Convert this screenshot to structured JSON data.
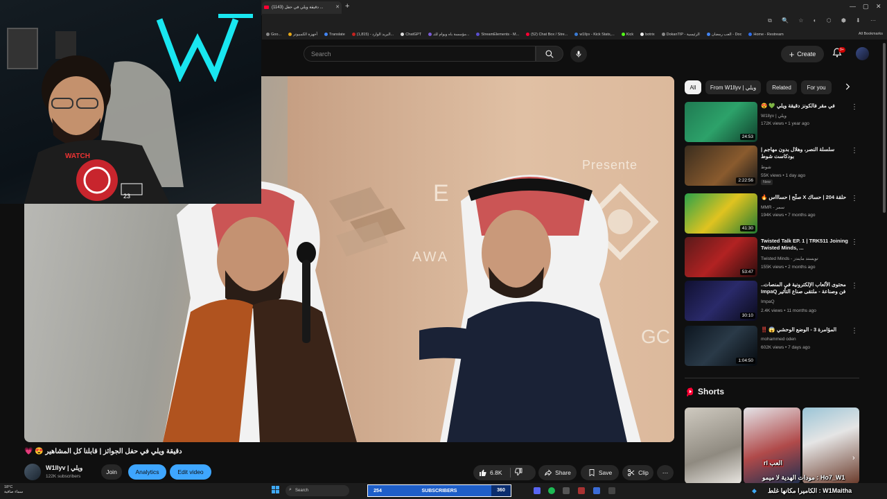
{
  "browser": {
    "tab_title": "(1143) دقيقة ويلي في حفل ...",
    "new_tab": "+",
    "bookmarks": [
      "Goo...",
      "أجهزة الكمبيوتر",
      "Translate",
      "البريد الوارد - (1,815)...",
      "ChatGPT",
      "مؤسسة باه ويوام للتـ...",
      "StreamElements - M...",
      "(52) Chat Box / Stre...",
      "w1llyv - Kick Stats,...",
      "Kick",
      "botrix",
      "DokanTIP - الرئيسية",
      "العب رمضان - Doc",
      "Home - Restream"
    ],
    "all_bookmarks": "All Bookmarks"
  },
  "header": {
    "search_placeholder": "Search",
    "create_label": "Create",
    "notif_badge": "9+"
  },
  "video": {
    "presente_text": "Presente",
    "wall_letters_1": "E",
    "wall_letters_2": "AWA",
    "wall_letters_3": "GC"
  },
  "watch": {
    "title": "دقيقة ويلي في حفل الجوائز | قابلنا كل المشاهير 😍 💗",
    "channel_name": "W1llyv | ويلي",
    "subscribers": "122K subscribers",
    "join": "Join",
    "analytics": "Analytics",
    "edit_video": "Edit video",
    "likes": "6.8K",
    "share": "Share",
    "save": "Save",
    "clip": "Clip"
  },
  "chips": [
    "All",
    "From W1llyv | ويلي",
    "Related",
    "For you"
  ],
  "recommendations": [
    {
      "title": "في مقر فالكونز دقيقة ويلي 💚 😍",
      "channel": "W1llyv | ويلي",
      "meta": "172K views • 1 year ago",
      "duration": "24:53",
      "new": ""
    },
    {
      "title": "سلسلة النصر، وهلال بدون مهاجم | بودكاست شوط",
      "channel": "شوط",
      "meta": "55K views • 1 day ago",
      "duration": "2:22:56",
      "new": "New"
    },
    {
      "title": "حلقة 204 | حساك X صلّح | حساااس 🔥",
      "channel": "MMR - سمر",
      "meta": "194K views • 7 months ago",
      "duration": "41:30",
      "new": ""
    },
    {
      "title": "Twisted Talk EP. 1 | TRK511 Joining Twisted Minds, ...",
      "channel": "Twisted Minds - تويستد مايندز",
      "meta": "155K views • 2 months ago",
      "duration": "53:47",
      "new": ""
    },
    {
      "title": "محتوى الألعاب الإلكترونية في المنصات.. فن وصناعة - ملتقى صناع التأثير ImpaQ",
      "channel": "ImpaQ",
      "meta": "2.4K views • 11 months ago",
      "duration": "30:10",
      "new": ""
    },
    {
      "title": "المؤامرة 3 - الوضع الوحشي 😱 ‼️",
      "channel": "mohammed oden",
      "meta": "602K views • 7 days ago",
      "duration": "1:04:50",
      "new": ""
    }
  ],
  "shorts": {
    "heading": "Shorts"
  },
  "overlay": {
    "cam_text": "WATCH",
    "cam_number": "23",
    "chat_lines": [
      "العب rl",
      "Ho7_W1 : مودات الهدية لا ميمو",
      "W1Maitha : الكاميرا مكانها غلط"
    ]
  },
  "taskbar": {
    "weather_temp": "18°C",
    "weather_desc": "سماء صافية",
    "search": "Search",
    "sub_count_left": "254",
    "sub_label": "SUBSCRIBERS",
    "sub_count_right": "360"
  },
  "colors": {
    "accent": "#3ea6ff",
    "brand_red": "#ff0033",
    "bg": "#0f0f0f",
    "chip": "#272727"
  }
}
